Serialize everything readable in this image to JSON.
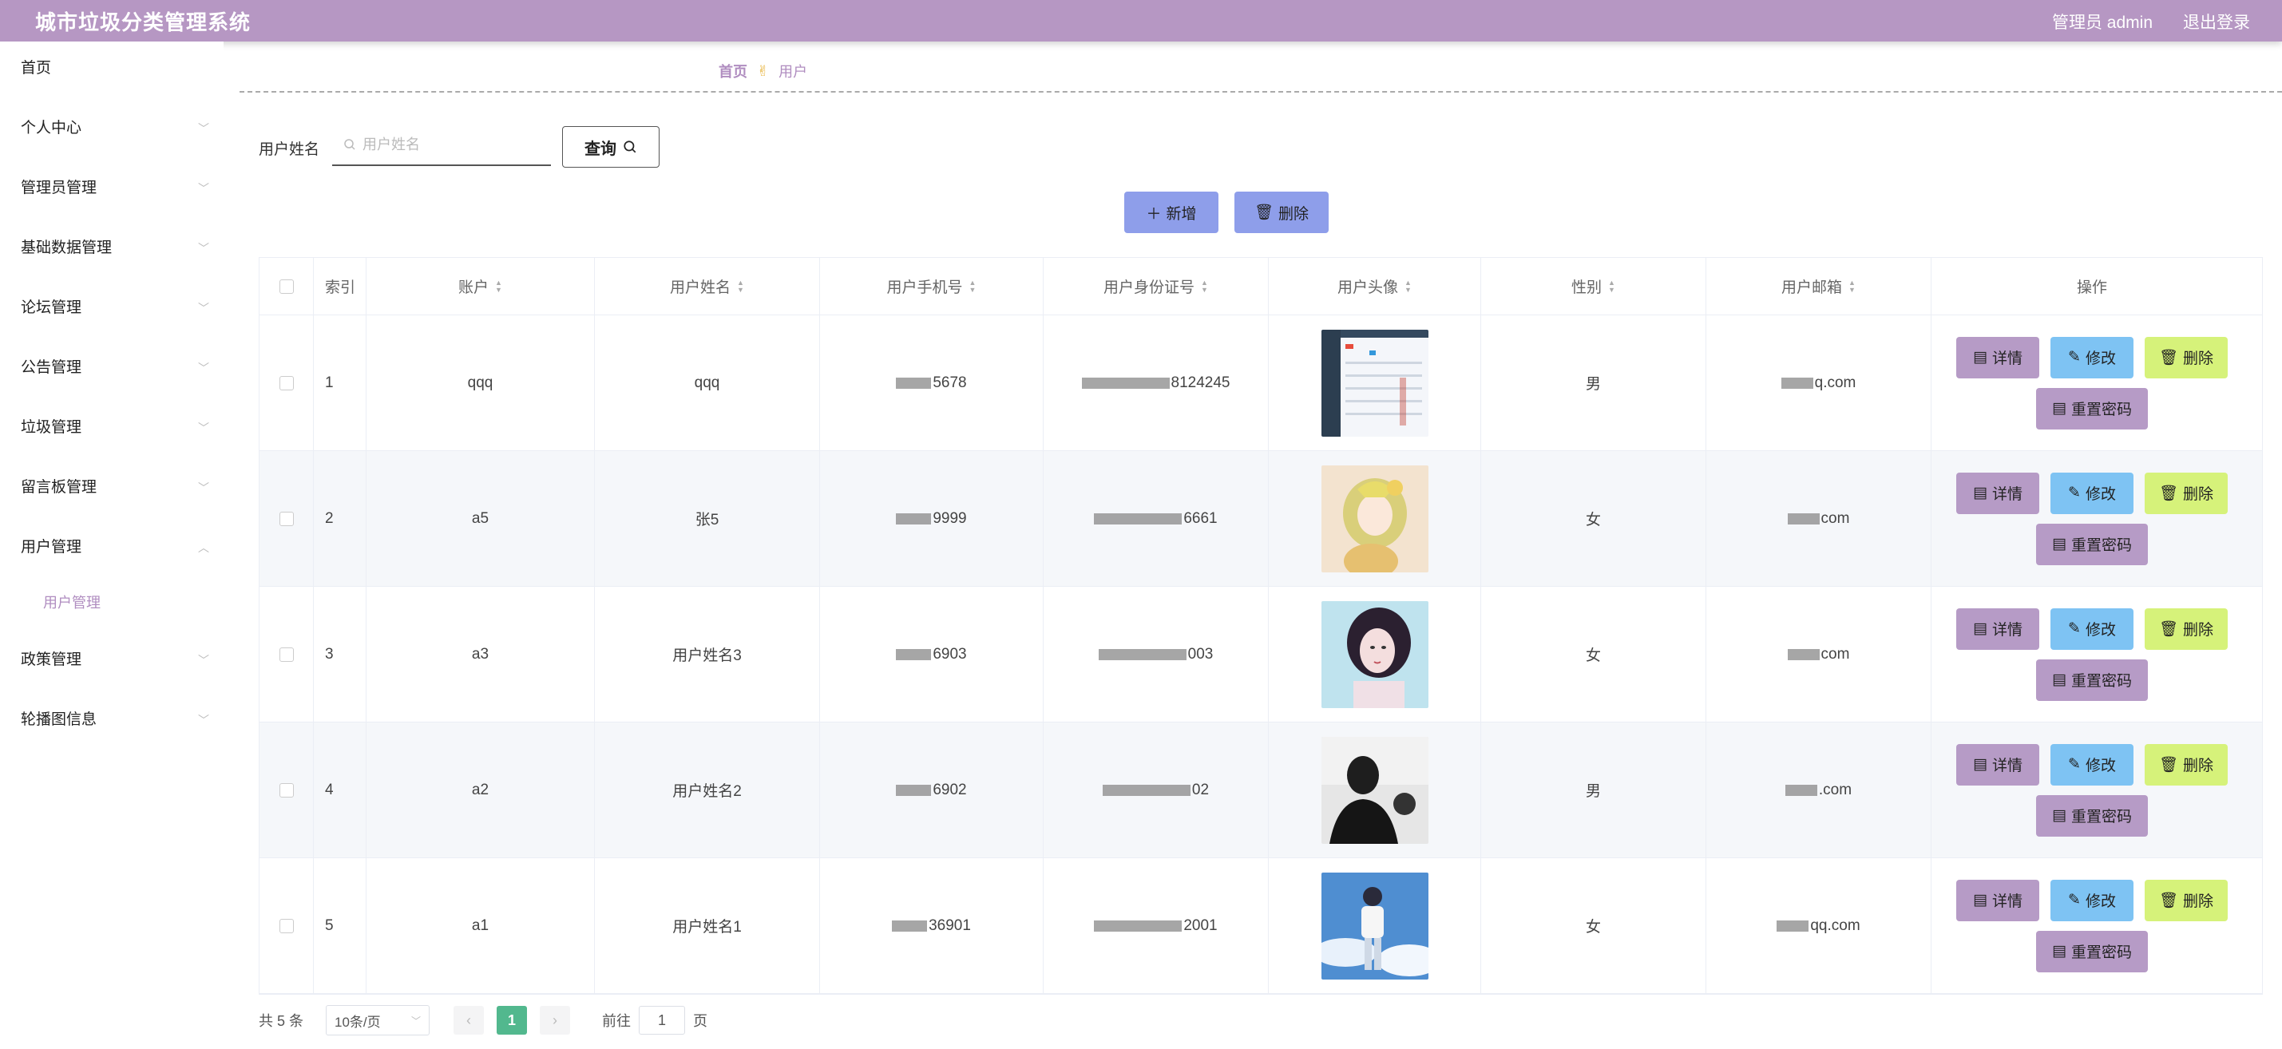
{
  "header": {
    "title": "城市垃圾分类管理系统",
    "user_label": "管理员 admin",
    "logout_label": "退出登录"
  },
  "sidebar": {
    "items": [
      {
        "label": "首页",
        "has_chevron": false
      },
      {
        "label": "个人中心",
        "has_chevron": true
      },
      {
        "label": "管理员管理",
        "has_chevron": true
      },
      {
        "label": "基础数据管理",
        "has_chevron": true
      },
      {
        "label": "论坛管理",
        "has_chevron": true
      },
      {
        "label": "公告管理",
        "has_chevron": true
      },
      {
        "label": "垃圾管理",
        "has_chevron": true
      },
      {
        "label": "留言板管理",
        "has_chevron": true
      },
      {
        "label": "用户管理",
        "has_chevron": true,
        "expanded": true
      },
      {
        "label": "政策管理",
        "has_chevron": true
      },
      {
        "label": "轮播图信息",
        "has_chevron": true
      }
    ],
    "sub_item": "用户管理"
  },
  "breadcrumb": {
    "home": "首页",
    "separator_icon": "✌",
    "current": "用户"
  },
  "search": {
    "label": "用户姓名",
    "placeholder": "用户姓名",
    "value": "",
    "button_label": "查询"
  },
  "actions": {
    "add_label": "新增",
    "delete_label": "删除"
  },
  "table": {
    "columns": [
      "索引",
      "账户",
      "用户姓名",
      "用户手机号",
      "用户身份证号",
      "用户头像",
      "性别",
      "用户邮箱",
      "操作"
    ],
    "rows": [
      {
        "index": "1",
        "account": "qqq",
        "name": "qqq",
        "phone": "5678",
        "id_number": "8124245",
        "gender": "男",
        "email": "q.com",
        "avatar": "screenshot"
      },
      {
        "index": "2",
        "account": "a5",
        "name": "张5",
        "phone": "9999",
        "id_number": "6661",
        "gender": "女",
        "email": "com",
        "avatar": "anime-girl"
      },
      {
        "index": "3",
        "account": "a3",
        "name": "用户姓名3",
        "phone": "6903",
        "id_number": "003",
        "gender": "女",
        "email": "com",
        "avatar": "girl-portrait"
      },
      {
        "index": "4",
        "account": "a2",
        "name": "用户姓名2",
        "phone": "6902",
        "id_number": "02",
        "gender": "男",
        "email": ".com",
        "avatar": "bw-silhouette"
      },
      {
        "index": "5",
        "account": "a1",
        "name": "用户姓名1",
        "phone": "36901",
        "id_number": "2001",
        "gender": "女",
        "email": "qq.com",
        "avatar": "boy-sky"
      }
    ],
    "row_actions": {
      "detail": "详情",
      "edit": "修改",
      "delete": "删除",
      "reset": "重置密码"
    }
  },
  "pagination": {
    "total": "共 5 条",
    "page_size": "10条/页",
    "current_page": "1",
    "goto_label": "前往",
    "goto_value": "1",
    "page_suffix": "页"
  },
  "colors": {
    "header_bg": "#b697c3",
    "accent": "#b08dc0",
    "detail_btn": "#b69bc6",
    "edit_btn": "#7ec3f3",
    "delete_btn": "#d6f27a",
    "add_btn": "#8e9eea",
    "page_active": "#52b88e"
  }
}
